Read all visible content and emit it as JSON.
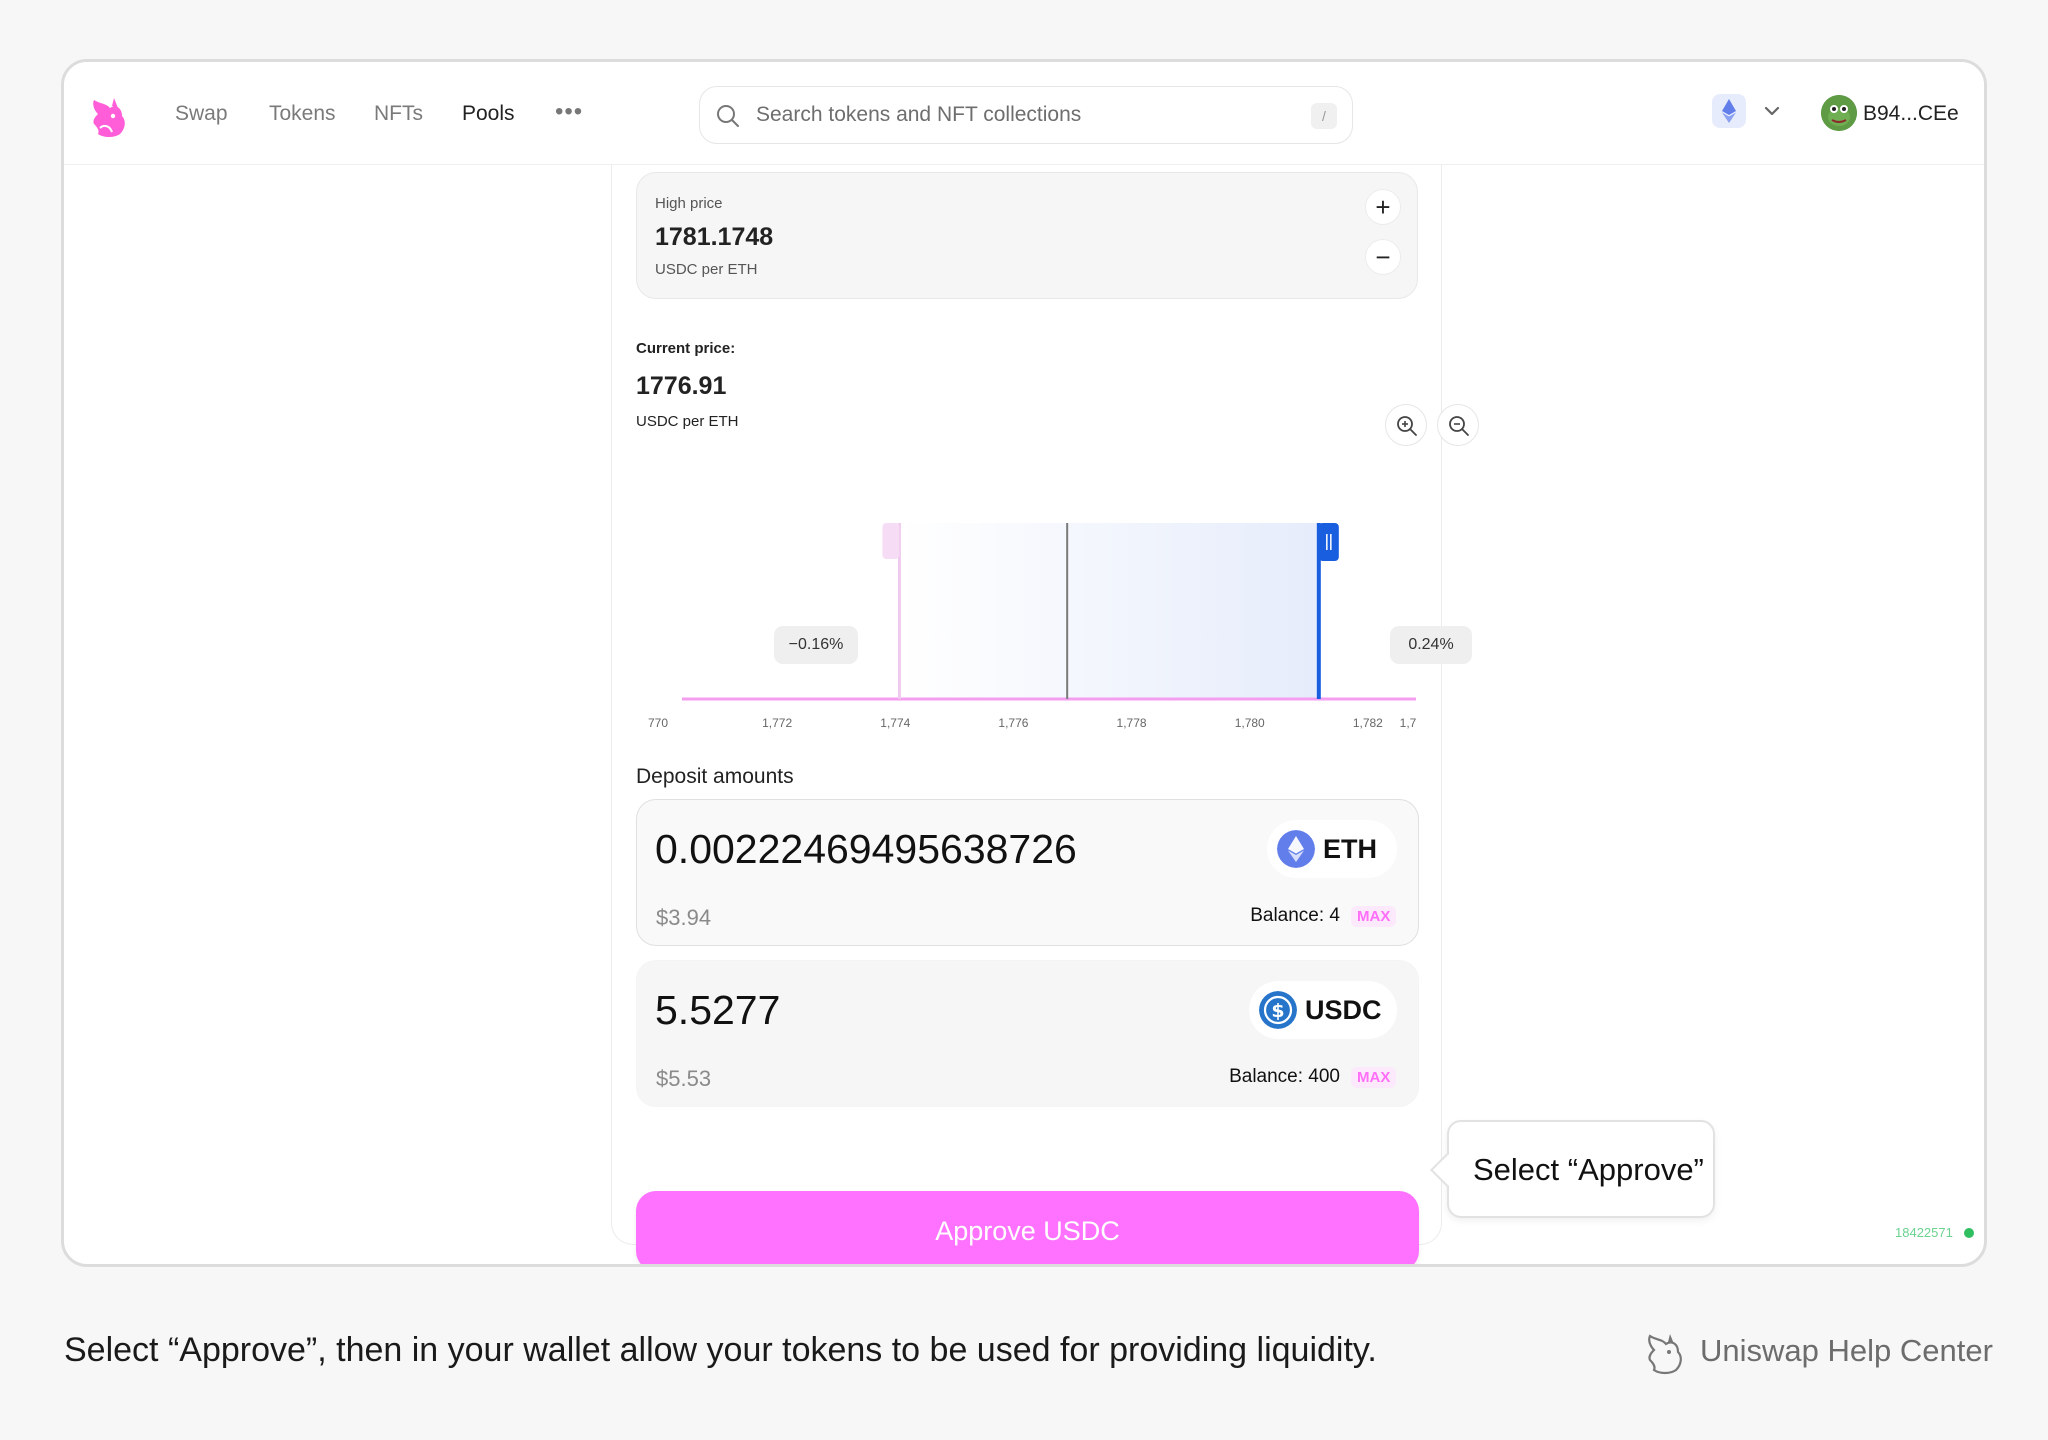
{
  "nav": {
    "logo_icon": "uniswap-unicorn-icon",
    "links": [
      "Swap",
      "Tokens",
      "NFTs",
      "Pools"
    ],
    "active_link": "Pools",
    "more_label": "•••",
    "search_placeholder": "Search tokens and NFT collections",
    "search_shortcut": "/",
    "network_icon": "ethereum-icon",
    "account": "B94...CEe",
    "brand_color": "#ff72ff"
  },
  "high_price": {
    "label": "High price",
    "value": "1781.1748",
    "unit": "USDC per ETH",
    "plus": "+",
    "minus": "−"
  },
  "current_price": {
    "label": "Current price:",
    "value": "1776.91",
    "unit": "USDC per ETH"
  },
  "chart_data": {
    "type": "area",
    "x_ticks": [
      "770",
      "1,772",
      "1,774",
      "1,776",
      "1,778",
      "1,780",
      "1,782",
      "1,7"
    ],
    "x_tick_values": [
      1770,
      1772,
      1774,
      1776,
      1778,
      1780,
      1782,
      1784
    ],
    "x_range": [
      1770,
      1784
    ],
    "current_price": 1776.91,
    "range_low": 1774.07,
    "range_high": 1781.17,
    "low_pct_label": "−0.16%",
    "high_pct_label": "0.24%",
    "colors": {
      "range_fill": "#e9eefc",
      "low_handle": "#f0c9ee",
      "high_handle": "#1a5ee0",
      "axis_line": "#f49ef0",
      "current_line": "#7a7a7a"
    }
  },
  "deposit": {
    "title": "Deposit amounts",
    "tokens": [
      {
        "amount": "0.00222469495638726",
        "usd": "$3.94",
        "symbol": "ETH",
        "icon": "ethereum-icon",
        "balance": "Balance: 4",
        "max": "MAX",
        "color": "#627eea"
      },
      {
        "amount": "5.5277",
        "usd": "$5.53",
        "symbol": "USDC",
        "icon": "usdc-icon",
        "balance": "Balance: 400",
        "max": "MAX",
        "color": "#2775ca"
      }
    ]
  },
  "approve_button": "Approve USDC",
  "callout": "Select “Approve”",
  "block_number": "18422571",
  "caption": "Select “Approve”, then in your wallet allow your tokens to be used for providing liquidity.",
  "help_center": "Uniswap Help Center"
}
